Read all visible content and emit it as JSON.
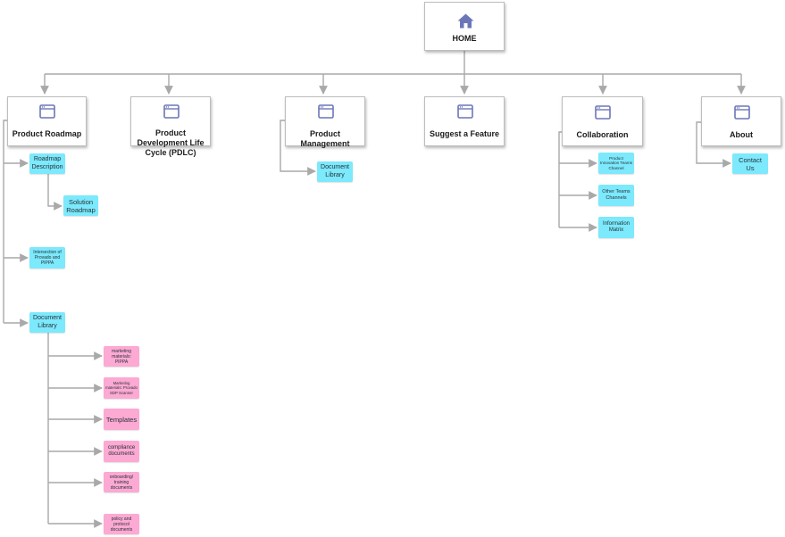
{
  "home": {
    "label": "HOME",
    "icon": "home-icon"
  },
  "sections": [
    {
      "id": "roadmap",
      "label": "Product Roadmap",
      "icon": "browser-window-icon"
    },
    {
      "id": "pdlc",
      "label": "Product Development Life Cycle (PDLC)",
      "icon": "browser-window-icon"
    },
    {
      "id": "management",
      "label": "Product Management",
      "icon": "browser-window-icon"
    },
    {
      "id": "suggest",
      "label": "Suggest a Feature",
      "icon": "browser-window-icon"
    },
    {
      "id": "collab",
      "label": "Collaboration",
      "icon": "browser-window-icon"
    },
    {
      "id": "about",
      "label": "About",
      "icon": "browser-window-icon"
    }
  ],
  "notes": {
    "roadmap_description": "Roadmap Description",
    "solution_roadmap": "Solution Roadmap",
    "intersection": "Intersection of Provado and PIPPA",
    "roadmap_document_library": "Document Library",
    "marketing_pippa": "marketing materials: PIPPA",
    "marketing_provado": "Marketing materials: Provado SDP Scanner",
    "templates": "Templates",
    "compliance": "compliance documents",
    "onboarding": "onboarding/ training documents",
    "policy": "policy and protocol documents",
    "management_document_library": "Document Library",
    "innovation_channel": "Product Innovation Teams Channel",
    "other_teams": "Other Teams Channels",
    "information_matrix": "Information Matrix",
    "contact_us": "Contact Us"
  },
  "colors": {
    "page_note": "#7ce9fc",
    "document_note": "#fca9d3",
    "icon": "#6b76b8",
    "connector": "#a9a9a9"
  }
}
